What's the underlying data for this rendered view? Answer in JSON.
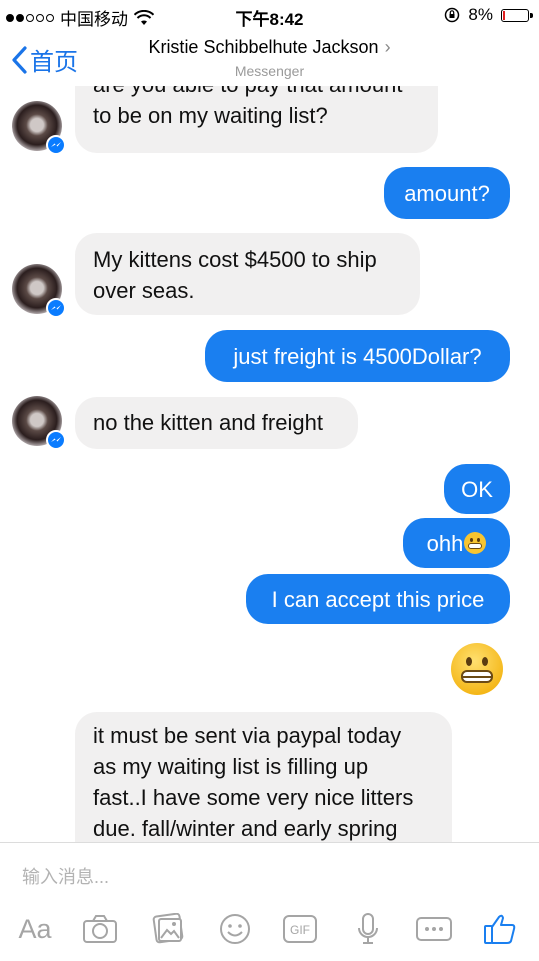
{
  "status_bar": {
    "carrier": "中国移动",
    "time": "下午8:42",
    "battery": "8%",
    "battery_level": 0.08
  },
  "header": {
    "back_label": "首页",
    "contact_name": "Kristie Schibbelhute Jackson",
    "chevron": "›",
    "app_name": "Messenger"
  },
  "messages": [
    {
      "from": "them",
      "lines": [
        "are you able to pay that amount",
        "to be on my waiting list?"
      ]
    },
    {
      "from": "me",
      "text": "amount?"
    },
    {
      "from": "them",
      "lines": [
        "My kittens cost $4500 to ship",
        "over seas."
      ]
    },
    {
      "from": "me",
      "text": "just freight is 4500Dollar?"
    },
    {
      "from": "them",
      "lines": [
        "no the kitten and freight"
      ]
    },
    {
      "from": "me",
      "text": "OK"
    },
    {
      "from": "me",
      "text": "ohh",
      "emoji": "grimacing-face"
    },
    {
      "from": "me",
      "text": "I can accept this price"
    },
    {
      "from": "me",
      "emoji": "grimacing-face"
    },
    {
      "from": "them",
      "lines": [
        "it must be sent via paypal today",
        "as my waiting list is filling up",
        "fast..I have some very nice litters",
        "due.  fall/winter and early spring"
      ]
    }
  ],
  "composer": {
    "placeholder": "输入消息...",
    "tools": [
      "Aa",
      "camera-icon",
      "photo-icon",
      "emoji-icon",
      "gif-icon",
      "microphone-icon",
      "more-icon",
      "thumbs-up-icon"
    ],
    "gif_label": "GIF"
  },
  "colors": {
    "accent": "#1a7ff0",
    "incoming_bubble": "#f1f0f0",
    "back_blue": "#1a74e8"
  }
}
